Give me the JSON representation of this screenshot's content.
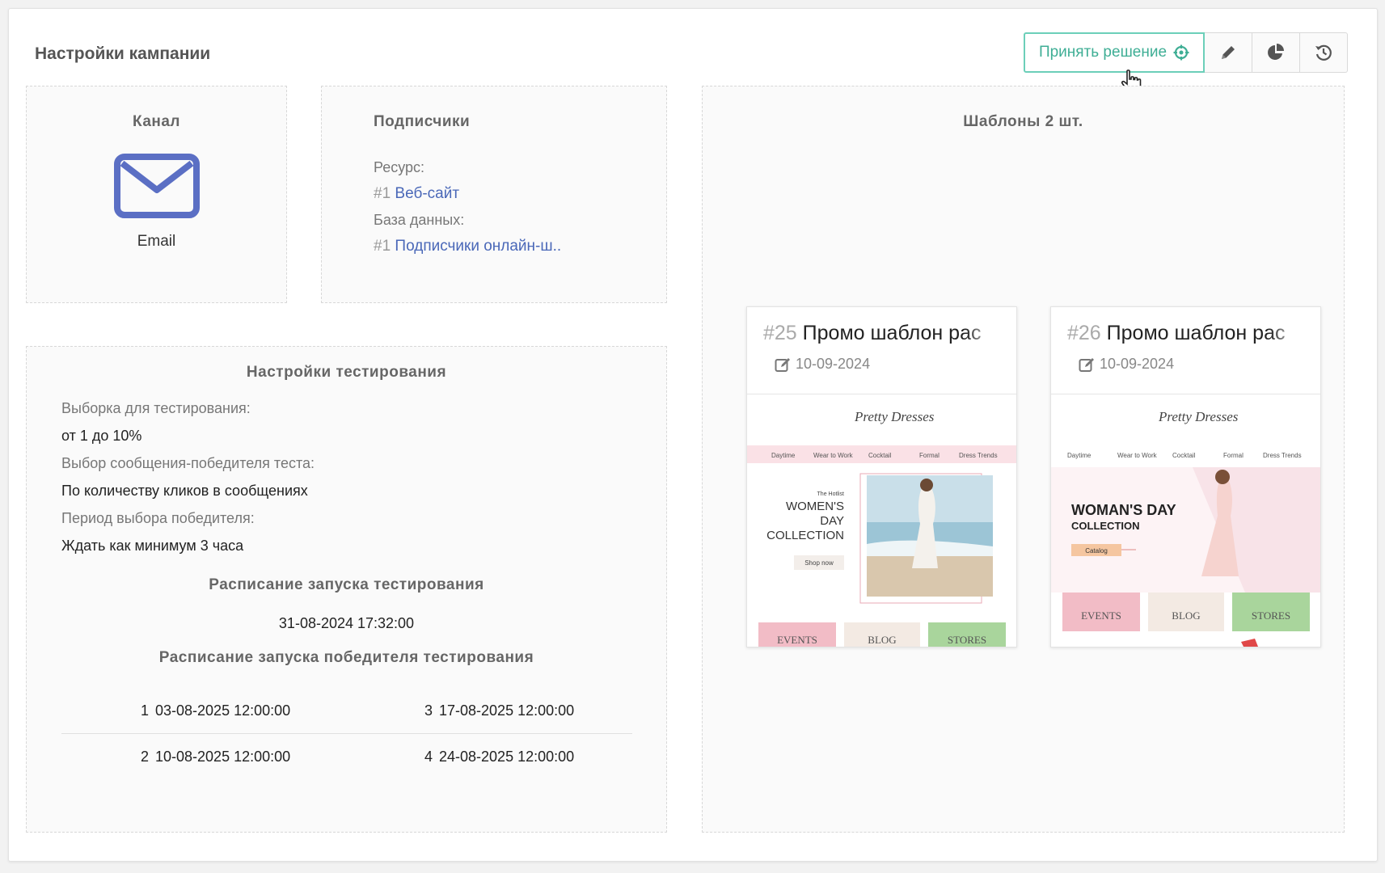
{
  "header": {
    "title": "Настройки кампании"
  },
  "toolbar": {
    "accept_label": "Принять решение",
    "accent_color": "#3fae95",
    "icons": [
      "target-icon",
      "pencil-icon",
      "pie-chart-icon",
      "history-icon"
    ]
  },
  "channel": {
    "title": "Канал",
    "icon": "envelope-icon",
    "icon_color": "#5b6fc4",
    "name": "Email"
  },
  "subscribers": {
    "title": "Подписчики",
    "resource_label": "Ресурс:",
    "resource_num": "#1",
    "resource_name": "Веб-сайт",
    "db_label": "База данных:",
    "db_num": "#1",
    "db_name": "Подписчики онлайн-ш.."
  },
  "templates": {
    "title": "Шаблоны 2 шт.",
    "items": [
      {
        "num": "#25",
        "name": "Промо шаблон рас",
        "date": "10-09-2024",
        "preview": {
          "brand": "Pretty Dresses",
          "nav": [
            "Daytime",
            "Wear to Work",
            "Cocktail",
            "Formal",
            "Dress Trends"
          ],
          "tag": "The Hotlist",
          "headline": [
            "WOMEN'S",
            "DAY",
            "COLLECTION"
          ],
          "cta": "Shop now",
          "tiles": [
            "EVENTS",
            "BLOG",
            "STORES"
          ]
        }
      },
      {
        "num": "#26",
        "name": "Промо шаблон рас",
        "date": "10-09-2024",
        "preview": {
          "brand": "Pretty Dresses",
          "nav": [
            "Daytime",
            "Wear to Work",
            "Cocktail",
            "Formal",
            "Dress Trends"
          ],
          "headline": [
            "WOMAN'S DAY",
            "COLLECTION"
          ],
          "cta": "Catalog",
          "tiles": [
            "EVENTS",
            "BLOG",
            "STORES"
          ]
        }
      }
    ]
  },
  "testing": {
    "title": "Настройки тестирования",
    "sample_label": "Выборка для тестирования:",
    "sample_value": "от 1 до 10%",
    "winner_choice_label": "Выбор сообщения-победителя теста:",
    "winner_choice_value": "По количеству кликов в сообщениях",
    "period_label": "Период выбора победителя:",
    "period_value": "Ждать как минимум 3 часа",
    "schedule_title": "Расписание запуска тестирования",
    "schedule_date": "31-08-2024 17:32:00",
    "winner_schedule_title": "Расписание запуска победителя тестирования",
    "winner_schedule": [
      {
        "n": "1",
        "date": "03-08-2025 12:00:00"
      },
      {
        "n": "3",
        "date": "17-08-2025 12:00:00"
      },
      {
        "n": "2",
        "date": "10-08-2025 12:00:00"
      },
      {
        "n": "4",
        "date": "24-08-2025 12:00:00"
      }
    ]
  }
}
